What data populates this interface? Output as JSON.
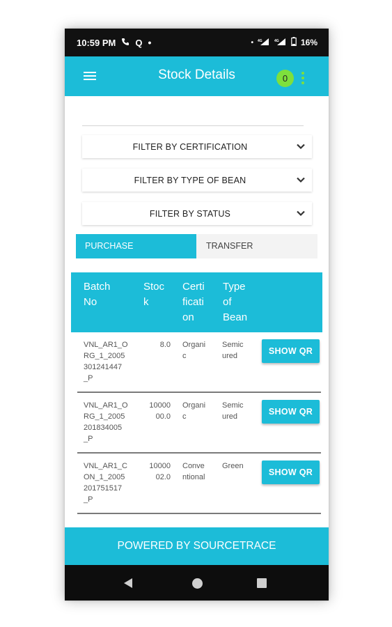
{
  "status_bar": {
    "time": "10:59 PM",
    "battery": "16%",
    "icons": [
      "phone-call-icon",
      "q-app-icon",
      "dot-icon",
      "hd-signal-icon",
      "4g-signal-icon",
      "battery-icon"
    ]
  },
  "app_bar": {
    "title": "Stock Details",
    "badge_count": "0",
    "menu_icon": "hamburger-icon",
    "overflow_icon": "kebab-icon"
  },
  "filters": [
    {
      "label": "FILTER BY CERTIFICATION"
    },
    {
      "label": "FILTER BY TYPE OF BEAN"
    },
    {
      "label": "FILTER BY STATUS"
    }
  ],
  "tabs": [
    {
      "label": "PURCHASE",
      "active": true
    },
    {
      "label": "TRANSFER",
      "active": false
    }
  ],
  "table": {
    "headers": [
      "Batch\nNo",
      "Stoc\nk",
      "Certi\nficati\non",
      "Type\nof\nBean"
    ],
    "rows": [
      {
        "batch": "VNL_AR1_O\nRG_1_2005\n301241447\n_P",
        "stock": "8.0",
        "certification": "Organi\nc",
        "bean": "Semic\nured",
        "action": "SHOW QR"
      },
      {
        "batch": "VNL_AR1_O\nRG_1_2005\n201834005\n_P",
        "stock": "10000\n00.0",
        "certification": "Organi\nc",
        "bean": "Semic\nured",
        "action": "SHOW QR"
      },
      {
        "batch": "VNL_AR1_C\nON_1_2005\n201751517\n_P",
        "stock": "10000\n02.0",
        "certification": "Conve\nntional",
        "bean": "Green",
        "action": "SHOW QR"
      }
    ]
  },
  "footer": {
    "text": "POWERED BY SOURCETRACE"
  },
  "nav_bar": {
    "icons": [
      "back-icon",
      "home-icon",
      "recents-icon"
    ]
  },
  "colors": {
    "primary": "#1cbcd8",
    "badge": "#7ee03c",
    "status_bar": "#111111",
    "nav_bar": "#0d0d0d"
  }
}
